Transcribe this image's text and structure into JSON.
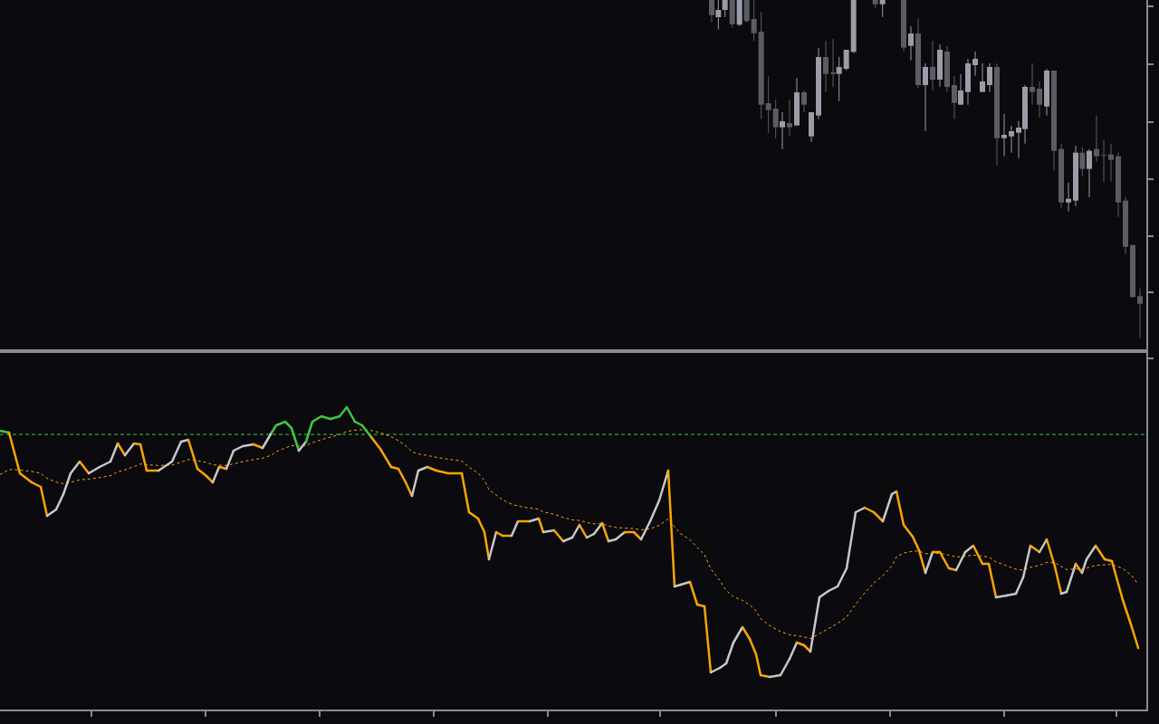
{
  "panes": [
    {
      "kind": "price"
    },
    {
      "kind": "indicator"
    }
  ]
}
